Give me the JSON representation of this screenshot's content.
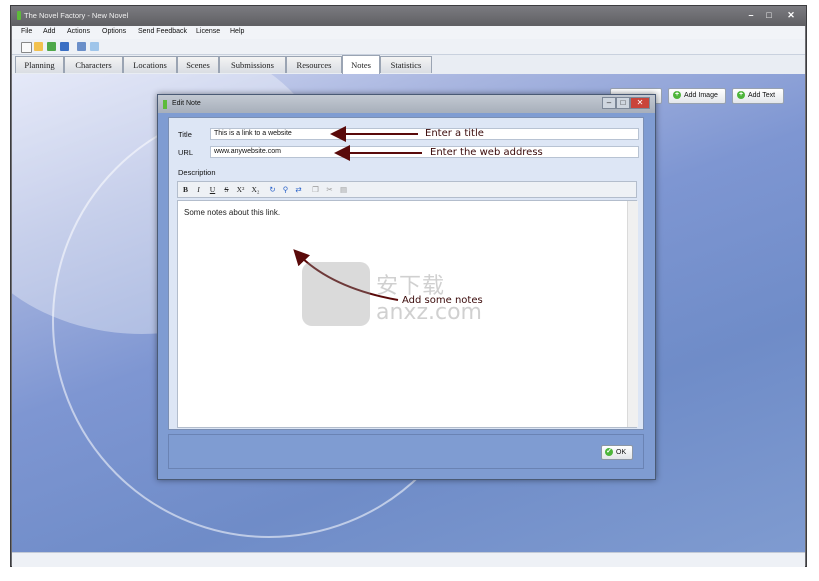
{
  "window": {
    "title": "The Novel Factory - New Novel",
    "controls": {
      "minimize": "–",
      "maximize": "□",
      "close": "✕"
    }
  },
  "menu": {
    "items": [
      "File",
      "Add",
      "Actions",
      "Options",
      "Send Feedback",
      "License",
      "Help"
    ]
  },
  "toolbar": {
    "icons": [
      "new-file-icon",
      "open-folder-icon",
      "export-icon",
      "save-icon",
      "layout-icon",
      "monitor-icon"
    ]
  },
  "tabs": {
    "items": [
      "Planning",
      "Characters",
      "Locations",
      "Scenes",
      "Submissions",
      "Resources",
      "Notes",
      "Statistics"
    ],
    "active": "Notes"
  },
  "notes_panel": {
    "add_image_label": "Add Image",
    "add_text_label": "Add Text"
  },
  "dialog": {
    "title": "Edit Note",
    "controls": {
      "minimize": "–",
      "maximize": "□",
      "close": "✕"
    },
    "title_label": "Title",
    "title_value": "This is a link to a website",
    "url_label": "URL",
    "url_value": "www.anywebsite.com",
    "description_label": "Description",
    "description_text": "Some notes about this link.",
    "ok_label": "OK",
    "editor_toolbar": {
      "bold": "B",
      "italic": "I",
      "underline": "U",
      "strike": "S",
      "superscript": "X²",
      "subscript": "X₂"
    }
  },
  "annotations": {
    "title_hint": "Enter a title",
    "url_hint": "Enter the web address",
    "notes_hint": "Add some notes"
  },
  "watermark": {
    "line1": "安下载",
    "line2": "anxz.com"
  },
  "colors": {
    "accent_green": "#4db53a",
    "annotation": "#5a0a0a",
    "background_blue": "#7f9cd2"
  }
}
